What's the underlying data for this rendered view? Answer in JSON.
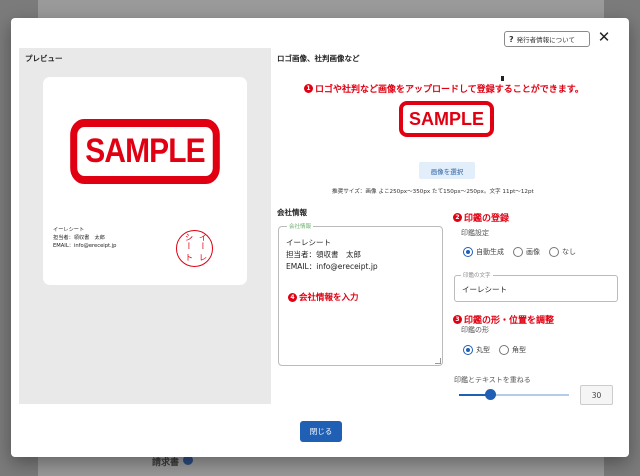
{
  "background": {
    "label": "請求書"
  },
  "header": {
    "help_label": "発行者情報について",
    "close_glyph": "✕"
  },
  "preview": {
    "title": "プレビュー",
    "logo_text": "SAMPLE",
    "lines": [
      "イーレシート",
      "担当者：領収書　太郎",
      "EMAIL：info@ereceipt.jp"
    ],
    "seal_cols": [
      "イー",
      "レ",
      "シー",
      "ト"
    ]
  },
  "logo_section": {
    "title": "ロゴ画像、社判画像など",
    "callout_num": "1",
    "callout": "ロゴや社判など画像をアップロードして登録することができます。",
    "logo_text": "SAMPLE",
    "select_button": "画像を選択",
    "recommend": "推奨サイズ：画像 よこ250px〜350px たて150px〜250px。文字 11pt〜12pt"
  },
  "company_section": {
    "title": "会社情報",
    "legend": "会社情報",
    "lines": [
      "イーレシート",
      "担当者：領収書　太郎",
      "EMAIL：info@ereceipt.jp"
    ],
    "callout_num": "4",
    "callout": "会社情報を入力"
  },
  "seal_section": {
    "callout_num": "2",
    "callout": "印鑑の登録",
    "setting_label": "印鑑設定",
    "options": [
      "自動生成",
      "画像",
      "なし"
    ],
    "selected": "自動生成",
    "text_legend": "印鑑の文字",
    "text_value": "イーレシート"
  },
  "shape_section": {
    "callout_num": "3",
    "callout": "印鑑の形・位置を調整",
    "shape_label": "印鑑の形",
    "options": [
      "丸型",
      "角型"
    ],
    "selected": "丸型",
    "overlap_label": "印鑑とテキストを重ねる",
    "overlap_value": "30"
  },
  "footer": {
    "close_button": "閉じる"
  },
  "colors": {
    "accent": "#1f5fb4",
    "stamp_red": "#e00012"
  }
}
